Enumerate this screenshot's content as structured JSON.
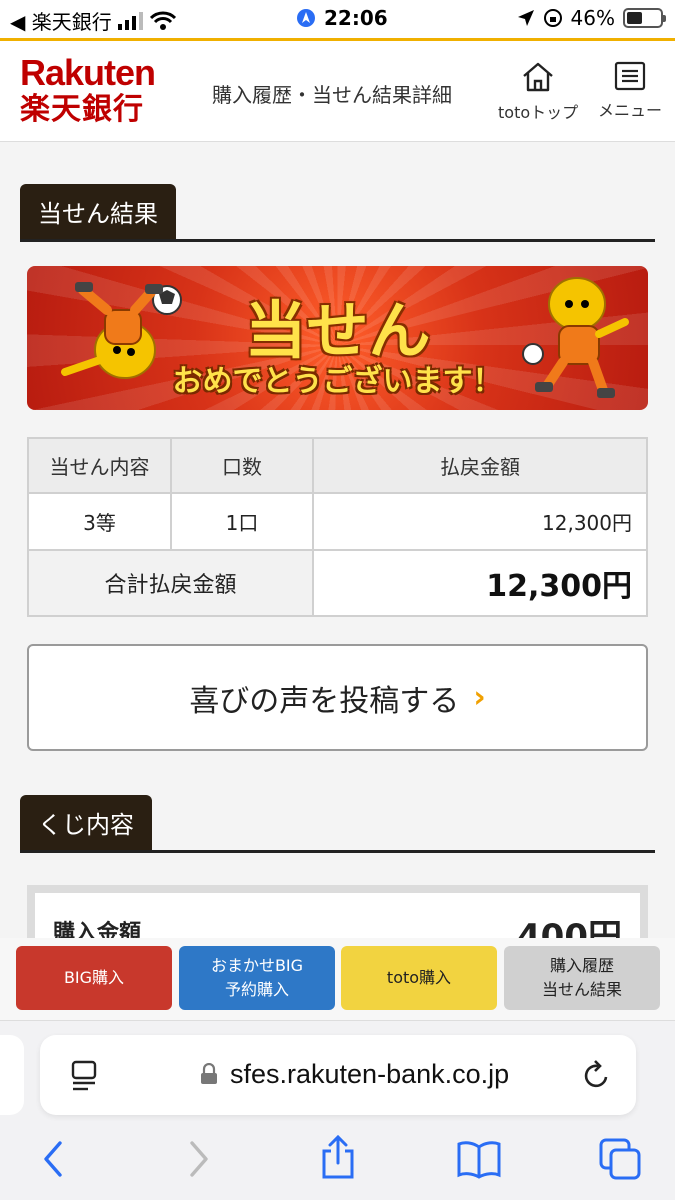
{
  "status_bar": {
    "back_app": "◀ 楽天銀行",
    "time": "22:06",
    "battery": "46%",
    "battery_level": 0.46
  },
  "header": {
    "logo_line1": "Rakuten",
    "logo_line2": "楽天銀行",
    "title": "購入履歴・当せん結果詳細",
    "toto_top_label": "totoトップ",
    "menu_label": "メニュー"
  },
  "result_section": {
    "heading": "当せん結果",
    "banner_title": "当せん",
    "banner_message": "おめでとうございます！",
    "table": {
      "headers": [
        "当せん内容",
        "口数",
        "払戻金額"
      ],
      "rows": [
        {
          "content": "3等",
          "count": "1口",
          "amount": "12,300円"
        }
      ],
      "total_label": "合計払戻金額",
      "total_amount": "12,300円"
    },
    "voice_button": "喜びの声を投稿する"
  },
  "lottery_section": {
    "heading": "くじ内容",
    "purchase_label": "購入金額",
    "purchase_amount": "400円"
  },
  "actions": {
    "big": "BIG購入",
    "omakase_line1": "おまかせBIG",
    "omakase_line2": "予約購入",
    "toto": "toto購入",
    "history_line1": "購入履歴",
    "history_line2": "当せん結果"
  },
  "browser": {
    "url": "sfes.rakuten-bank.co.jp"
  },
  "colors": {
    "brand_red": "#bf0000",
    "accent_yellow": "#f0b000",
    "big_button": "#c8382c",
    "omakase_button": "#2e78c7",
    "toto_button": "#f2d340",
    "history_button": "#d0d0d0"
  }
}
